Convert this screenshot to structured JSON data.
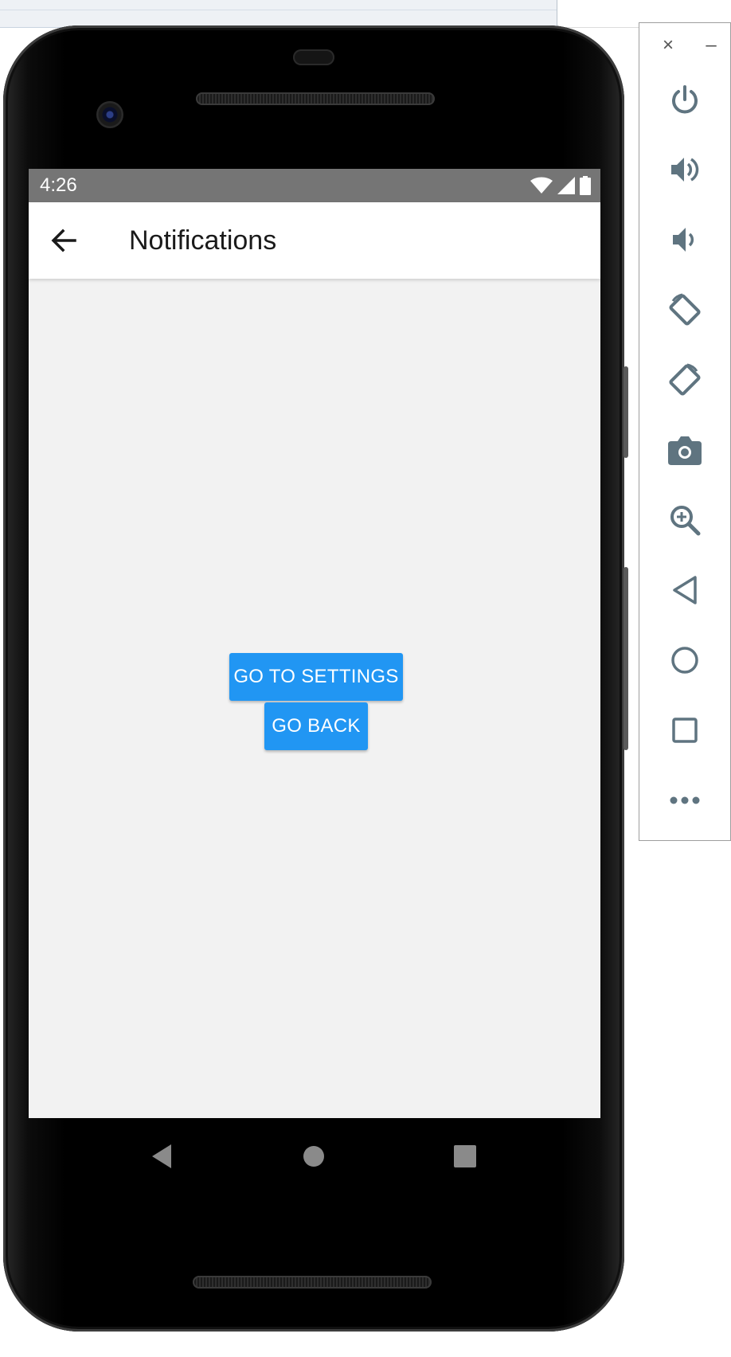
{
  "device": {
    "status_bar": {
      "time": "4:26"
    },
    "app_bar": {
      "title": "Notifications"
    },
    "buttons": {
      "go_to_settings": "GO TO SETTINGS",
      "go_back": "GO BACK"
    }
  },
  "emulator_panel": {
    "close_symbol": "×",
    "minimize_symbol": "–",
    "tools": [
      "power-icon",
      "volume-up-icon",
      "volume-down-icon",
      "rotate-left-icon",
      "rotate-right-icon",
      "camera-icon",
      "zoom-icon",
      "back-icon",
      "home-icon",
      "overview-icon",
      "more-icon"
    ]
  },
  "colors": {
    "accent": "#2196f3",
    "status_bar": "#757575",
    "screen_background": "#f2f2f2",
    "panel_icon": "#5f7480"
  }
}
